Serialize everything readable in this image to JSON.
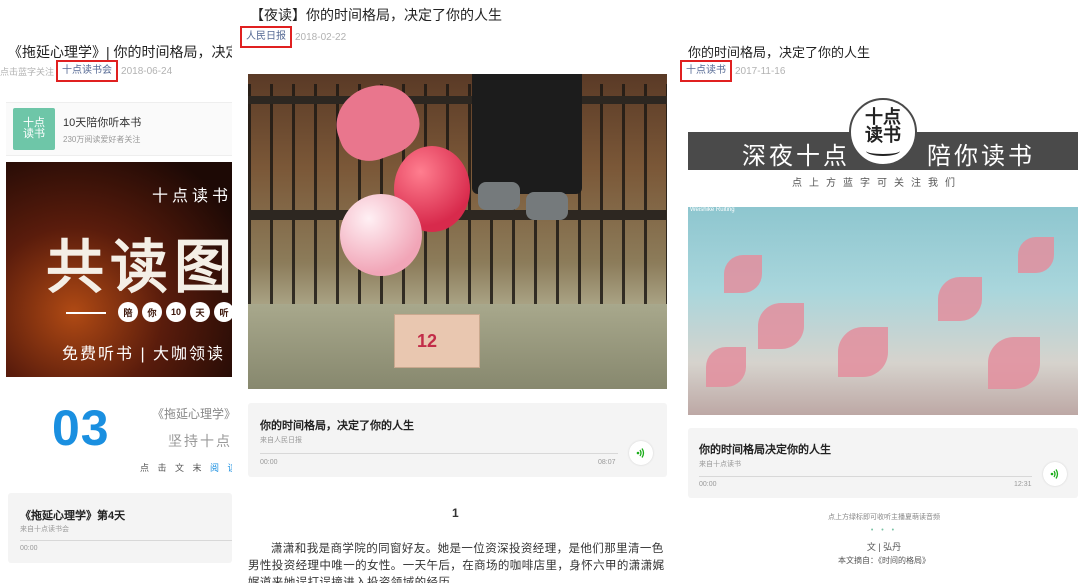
{
  "left": {
    "title": "《拖延心理学》| 你的时间格局，决定了你的人生",
    "meta_hint": "点击蓝字关注",
    "source": "十点读书会",
    "date": "2018-06-24",
    "profile": {
      "avatar_text": "十点\n读书",
      "name": "10天陪你听本书",
      "desc": "230万阅读爱好者关注"
    },
    "banner": {
      "brand": "十点读书",
      "headline": "共读图书",
      "circles": [
        "陪",
        "你",
        "10",
        "天",
        "听"
      ],
      "subtitle": "免费听书 | 大咖领读"
    },
    "day_card": {
      "number": "03",
      "book": "《拖延心理学》",
      "motto": "坚持十点共读",
      "hint_prefix": "点 击 文 末 ",
      "hint_blue": "阅 读 原"
    },
    "audio": {
      "title": "《拖延心理学》第4天",
      "source": "来自十点读书会",
      "start_time": "00:00"
    }
  },
  "middle": {
    "title": "【夜读】你的时间格局，决定了你的人生",
    "source": "人民日报",
    "date": "2018-02-22",
    "photo_box_text": "12",
    "audio": {
      "title": "你的时间格局，决定了你的人生",
      "source": "来自人民日报",
      "start_time": "00:00",
      "end_time": "08:07"
    },
    "section_number": "1",
    "body": "潇潇和我是商学院的同窗好友。她是一位资深投资经理，是他们那里清一色男性投资经理中唯一的女性。一天午后，在商场的咖啡店里，身怀六甲的潇潇娓娓道来她误打误撞进入投资领域的经历。"
  },
  "right": {
    "title": "你的时间格局，决定了你的人生",
    "source": "十点读书",
    "date": "2017-11-16",
    "banner": {
      "left_text": "深夜十点",
      "right_text": "陪你读书",
      "logo_text": "十点\n读书"
    },
    "follow_hint": "点上方蓝字可关注我们",
    "photo_watermark": "Weishike Ruiting",
    "audio": {
      "title": "你的时间格局决定你的人生",
      "source": "来自十点读书",
      "start_time": "00:00",
      "end_time": "12:31"
    },
    "share_hint": "点上方绿标即可收听主播夏萌读音频",
    "dots": "• • •",
    "author": "文 | 弘丹",
    "excerpt": "本文摘自：《时间的格局》"
  },
  "icons": {
    "play": "sound-wave-icon"
  },
  "colors": {
    "highlight_border": "#e02020",
    "link": "#576b95",
    "play_green": "#1aad19",
    "accent_blue": "#1a8fe0"
  }
}
